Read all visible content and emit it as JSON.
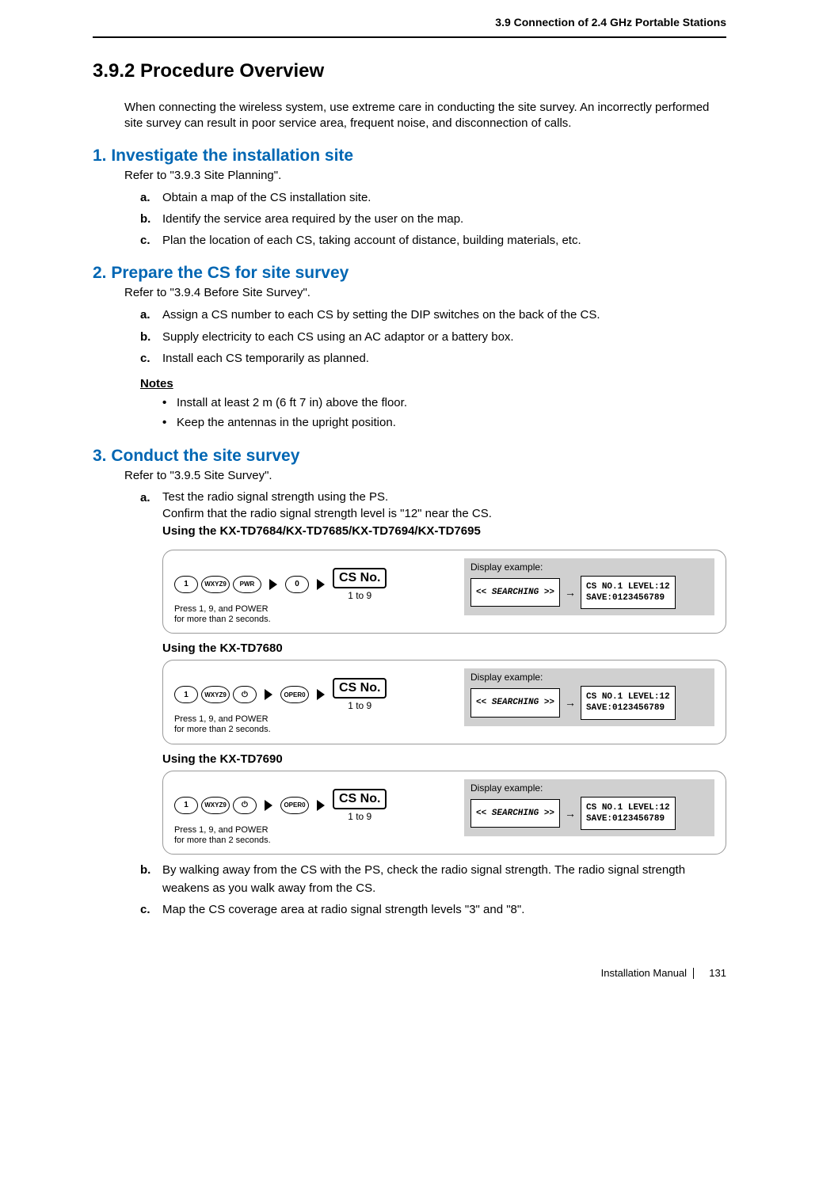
{
  "header": {
    "section_header": "3.9 Connection of 2.4 GHz Portable Stations"
  },
  "title": "3.9.2     Procedure Overview",
  "intro": "When connecting the wireless system, use extreme care in conducting the site survey. An incorrectly performed site survey can result in poor service area, frequent noise, and disconnection of calls.",
  "step1": {
    "heading": "1. Investigate the installation site",
    "refer": "Refer to \"3.9.3 Site Planning\".",
    "a": "Obtain a map of the CS installation site.",
    "b": "Identify the service area required by the user on the map.",
    "c": "Plan the location of each CS, taking account of distance, building materials, etc."
  },
  "step2": {
    "heading": "2. Prepare the CS for site survey",
    "refer": "Refer to \"3.9.4 Before Site Survey\".",
    "a": "Assign a CS number to each CS by setting the DIP switches on the back of the CS.",
    "b": "Supply electricity to each CS using an AC adaptor or a battery box.",
    "c": "Install each CS temporarily as planned.",
    "notes_heading": "Notes",
    "note1": "Install at least 2 m (6 ft 7 in) above the floor.",
    "note2": "Keep the antennas in the upright position."
  },
  "step3": {
    "heading": "3. Conduct the site survey",
    "refer": "Refer to \"3.9.5 Site Survey\".",
    "a_line1": "Test the radio signal strength using the PS.",
    "a_line2": "Confirm that the radio signal strength level is \"12\" near the CS.",
    "a_bold": "Using the KX-TD7684/KX-TD7685/KX-TD7694/KX-TD7695",
    "dia_common": {
      "press_note": "Press 1, 9, and POWER\nfor more than 2 seconds.",
      "csno": "CS No.",
      "csno_sub": "1 to 9",
      "display_label": "Display example:",
      "lcd_search": "<< SEARCHING >>",
      "lcd_result": "CS NO.1 LEVEL:12\nSAVE:0123456789",
      "key1": "1",
      "key9": "WXYZ9",
      "key0": "0",
      "oper0": "OPER0",
      "pwr": "PWR"
    },
    "dia2_title": "Using the KX-TD7680",
    "dia3_title": "Using the KX-TD7690",
    "b": "By walking away from the CS with the PS, check the radio signal strength. The radio signal strength weakens as you walk away from the CS.",
    "c": "Map the CS coverage area at radio signal strength levels \"3\" and \"8\"."
  },
  "footer": {
    "manual": "Installation Manual",
    "page": "131"
  }
}
